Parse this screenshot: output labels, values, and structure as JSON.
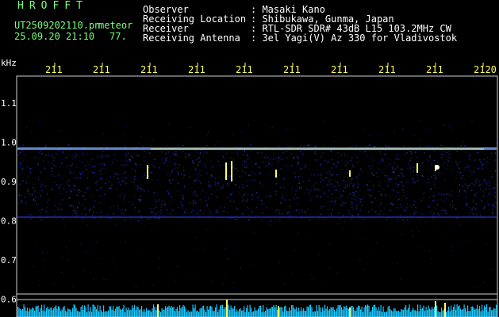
{
  "header": {
    "title": "HROFFT",
    "filename": "UT2509202110.pn",
    "detector": "meteor",
    "datetime": "25.09.20 21:10",
    "count": "77."
  },
  "station": [
    {
      "label": "Observer",
      "value": ": Masaki Kano"
    },
    {
      "label": "Receiving Location",
      "value": ": Shibukawa, Gunma, Japan"
    },
    {
      "label": "Receiver",
      "value": ": RTL-SDR SDR# 43dB L15 103.2MHz CW"
    },
    {
      "label": "Receiving Antenna",
      "value": ": 3el Yagi(V) Az 330 for Vladivostok"
    }
  ],
  "axis": {
    "unit": "kHz",
    "time_ticks": [
      "211",
      "211",
      "211",
      "211",
      "211",
      "211",
      "211",
      "211",
      "211",
      "2120"
    ],
    "freq_ticks": [
      "1.1",
      "1.0",
      "0.9",
      "0.8",
      "0.7",
      "0.6"
    ]
  },
  "colors": {
    "background": "#000000",
    "text": "#FFFFFF",
    "title": "#7CFF7C",
    "time_ticks": "#FFFF55",
    "noise": "#1E2EA8",
    "carrier": "#7FA8FF",
    "echo": "#FFFF66",
    "bars": "#19C8FF"
  }
}
